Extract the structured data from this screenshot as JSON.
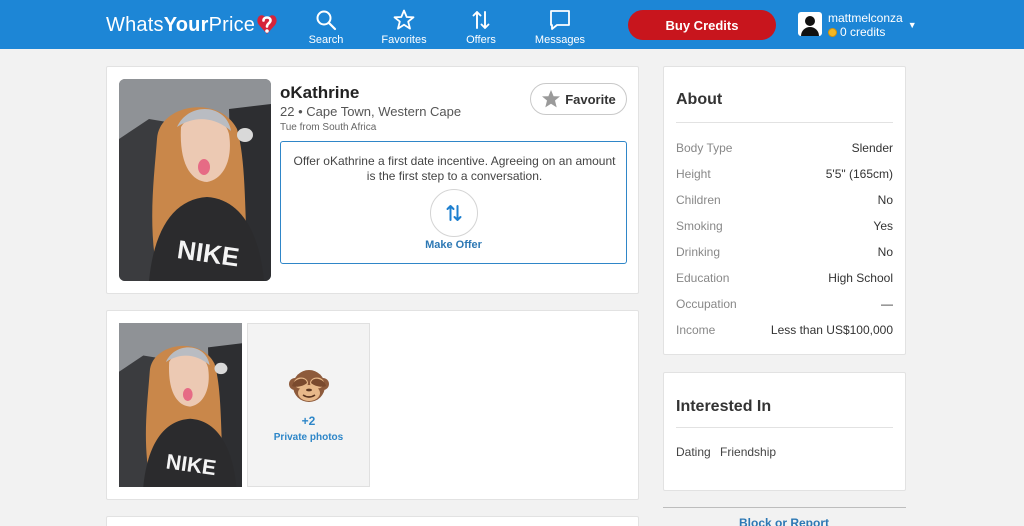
{
  "header": {
    "logo": {
      "part1": "Whats",
      "part2": "Your",
      "part3": "Price"
    },
    "nav": {
      "search": "Search",
      "favorites": "Favorites",
      "offers": "Offers",
      "messages": "Messages"
    },
    "buy_credits": "Buy Credits",
    "account": {
      "username": "mattmelconza",
      "credits": "0 credits"
    }
  },
  "profile": {
    "name": "oKathrine",
    "info": "22 • Cape Town, Western Cape",
    "online": "Tue from South Africa",
    "favorite_label": "Favorite",
    "offer_text": "Offer oKathrine a first date incentive. Agreeing on an amount is the first step to a conversation.",
    "make_offer_label": "Make Offer"
  },
  "photos": {
    "private_count": "+2",
    "private_label": "Private photos"
  },
  "about": {
    "title": "About",
    "rows": [
      {
        "key": "Body Type",
        "value": "Slender"
      },
      {
        "key": "Height",
        "value": "5'5\" (165cm)"
      },
      {
        "key": "Children",
        "value": "No"
      },
      {
        "key": "Smoking",
        "value": "Yes"
      },
      {
        "key": "Drinking",
        "value": "No"
      },
      {
        "key": "Education",
        "value": "High School"
      },
      {
        "key": "Occupation",
        "value": "—"
      },
      {
        "key": "Income",
        "value": "Less than US$100,000"
      }
    ]
  },
  "interested": {
    "title": "Interested In",
    "tags": [
      "Dating",
      "Friendship"
    ]
  },
  "footer": {
    "block_report": "Block or Report"
  },
  "colors": {
    "header": "#1d86d6",
    "buy": "#c8151d",
    "accent": "#2d78b4"
  },
  "icons": [
    "search-icon",
    "star-icon",
    "offers-arrows-icon",
    "message-icon",
    "monkey-icon",
    "heart-question-icon"
  ]
}
